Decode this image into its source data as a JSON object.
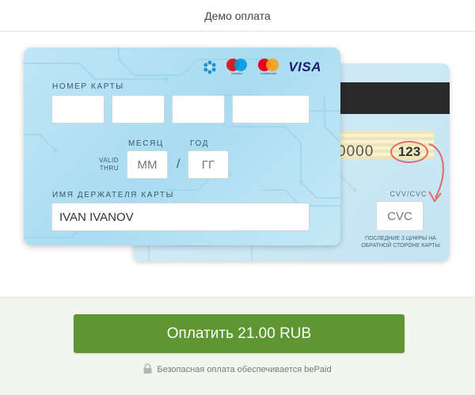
{
  "header": {
    "title": "Демо оплата"
  },
  "front_card": {
    "logos": {
      "belcart": "belcart-icon",
      "maestro_text": "maestro",
      "mastercard_text": "mastercard",
      "visa_text": "VISA"
    },
    "number_label": "НОМЕР КАРТЫ",
    "number_fields": [
      "",
      "",
      "",
      ""
    ],
    "month_label": "МЕСЯЦ",
    "year_label": "ГОД",
    "valid_thru_line1": "VALID",
    "valid_thru_line2": "THRU",
    "month_placeholder": "ММ",
    "year_placeholder": "ГГ",
    "separator": "/",
    "holder_label": "ИМЯ ДЕРЖАТЕЛЯ КАРТЫ",
    "holder_value": "IVAN IVANOV"
  },
  "back_card": {
    "signature_digits": "0000",
    "cvv_example": "123",
    "cvv_label": "CVV/CVC",
    "cvc_placeholder": "CVC",
    "hint_line1": "ПОСЛЕДНИЕ 3 ЦИФРЫ НА",
    "hint_line2": "ОБРАТНОЙ СТОРОНЕ КАРТЫ"
  },
  "footer": {
    "pay_button": "Оплатить 21.00 RUB",
    "secure_text": "Безопасная оплата обеспечивается bePaid"
  },
  "colors": {
    "accent_button": "#5e9632",
    "card_front": "#b3e0f3",
    "card_back": "#cfe9f5",
    "cvv_circle": "#e06a6a"
  }
}
